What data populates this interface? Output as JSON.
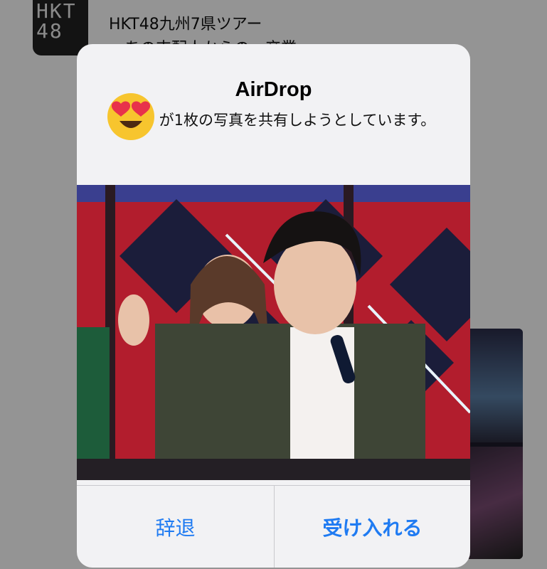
{
  "background_app": {
    "avatar_logo": "HKT 48",
    "tweet_title_line1": "HKT48九州7県ツアー",
    "tweet_title_line2": "～あの支配人からの、卒業"
  },
  "alert": {
    "title": "AirDrop",
    "message": "が1枚の写真を共有しようとしています。",
    "sender_icon": "heart-eyes-emoji-icon",
    "decline_label": "辞退",
    "accept_label": "受け入れる"
  },
  "colors": {
    "button_text": "#1f7bf2",
    "alert_bg": "#f2f2f4",
    "stage_red": "#b21d2d",
    "stage_dark": "#1b1d3a"
  }
}
